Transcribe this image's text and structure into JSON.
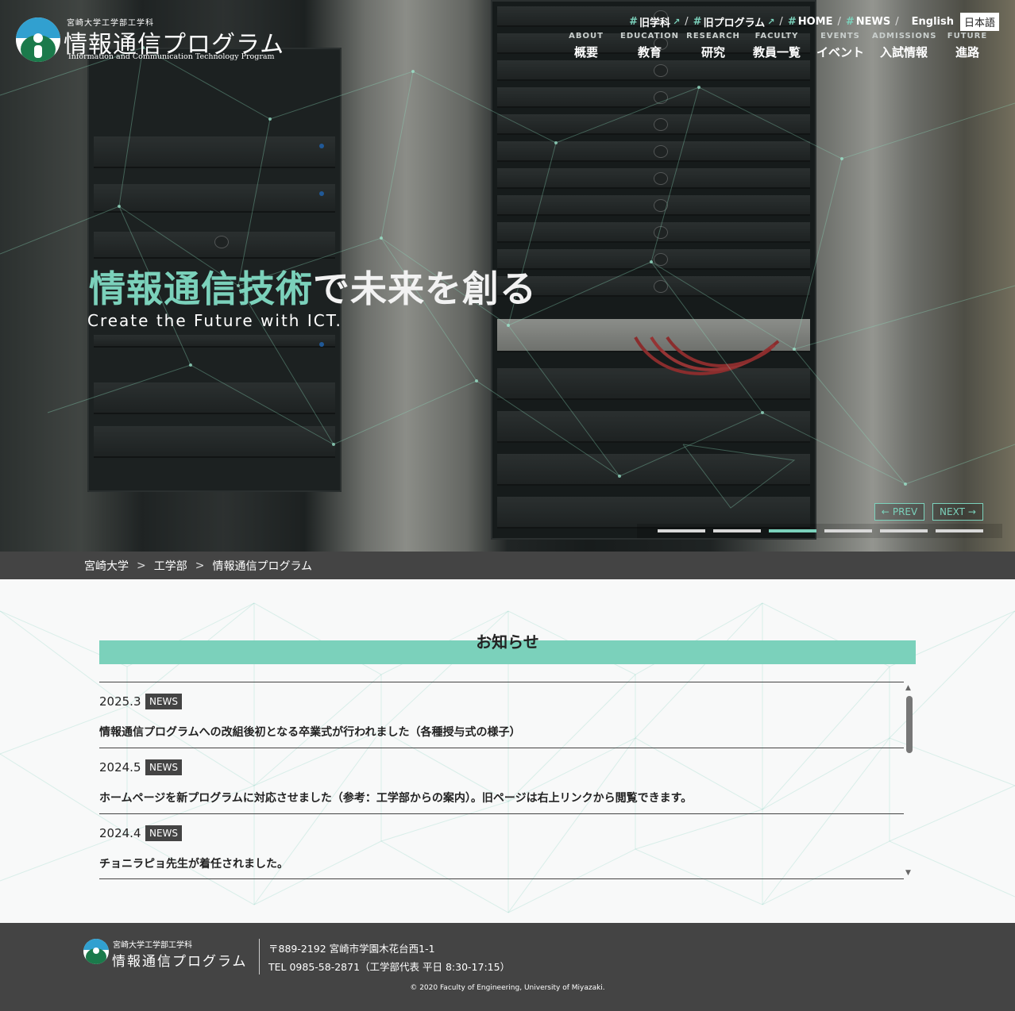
{
  "header": {
    "logo_small": "宮崎大学工学部工学科",
    "logo_title": "情報通信プログラム",
    "logo_en": "Information and Communication Technology Program",
    "top_links": [
      {
        "label": "旧学科",
        "external": true
      },
      {
        "label": "旧プログラム",
        "external": true
      },
      {
        "label": "HOME",
        "external": false
      },
      {
        "label": "NEWS",
        "external": false
      }
    ],
    "lang_en": "English",
    "lang_ja": "日本語",
    "nav": [
      {
        "en": "ABOUT",
        "ja": "概要"
      },
      {
        "en": "EDUCATION",
        "ja": "教育"
      },
      {
        "en": "RESEARCH",
        "ja": "研究"
      },
      {
        "en": "FACULTY",
        "ja": "教員一覧"
      },
      {
        "en": "EVENTS",
        "ja": "イベント"
      },
      {
        "en": "ADMISSIONS",
        "ja": "入試情報"
      },
      {
        "en": "FUTURE",
        "ja": "進路"
      }
    ]
  },
  "hero": {
    "headline_accent": "情報通信技術",
    "headline_rest": "で未来を創る",
    "subline": "Create the Future with ICT.",
    "prev_label": "PREV",
    "next_label": "NEXT",
    "slide_count": 6,
    "active_slide": 3
  },
  "breadcrumb": [
    "宮崎大学",
    "工学部",
    "情報通信プログラム"
  ],
  "news": {
    "title": "お知らせ",
    "items": [
      {
        "date": "2025.3",
        "tag": "NEWS",
        "text": "情報通信プログラムへの改組後初となる卒業式が行われました（各種授与式の様子）"
      },
      {
        "date": "2024.5",
        "tag": "NEWS",
        "text": "ホームページを新プログラムに対応させました（参考：工学部からの案内）。旧ページは右上リンクから閲覧できます。"
      },
      {
        "date": "2024.4",
        "tag": "NEWS",
        "text": "チョニラピョ先生が着任されました。"
      }
    ]
  },
  "footer": {
    "small": "宮崎大学工学部工学科",
    "title": "情報通信プログラム",
    "address": "〒889-2192 宮崎市学園木花台西1-1",
    "tel": "TEL 0985-58-2871（工学部代表 平日 8:30-17:15）",
    "copyright": "© 2020 Faculty of Engineering, University of Miyazaki."
  },
  "colors": {
    "accent": "#7bd1bb",
    "dark": "#444444"
  }
}
